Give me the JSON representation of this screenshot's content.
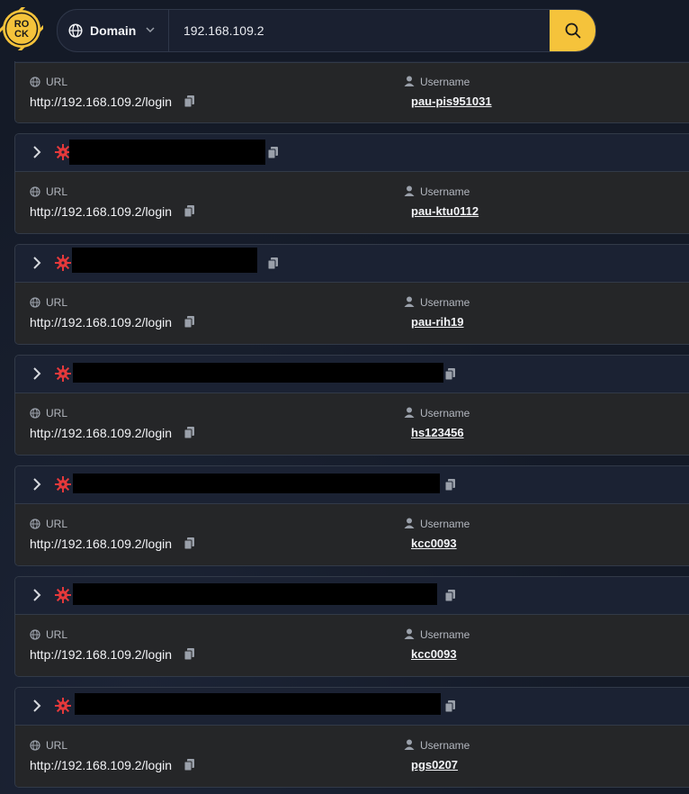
{
  "search": {
    "mode_label": "Domain",
    "query": "192.168.109.2"
  },
  "logo_text": "ROCK",
  "colors": {
    "accent": "#f5c33b",
    "virus": "#e5393b",
    "background": "#141a27"
  },
  "labels": {
    "url": "URL",
    "username": "Username"
  },
  "results": [
    {
      "url": "http://192.168.109.2/login",
      "username": "pau-pis951031"
    },
    {
      "url": "http://192.168.109.2/login",
      "username": "pau-ktu0112"
    },
    {
      "url": "http://192.168.109.2/login",
      "username": "pau-rih19"
    },
    {
      "url": "http://192.168.109.2/login",
      "username": "hs123456"
    },
    {
      "url": "http://192.168.109.2/login",
      "username": "kcc0093"
    },
    {
      "url": "http://192.168.109.2/login",
      "username": "kcc0093"
    },
    {
      "url": "http://192.168.109.2/login",
      "username": "pgs0207"
    }
  ]
}
